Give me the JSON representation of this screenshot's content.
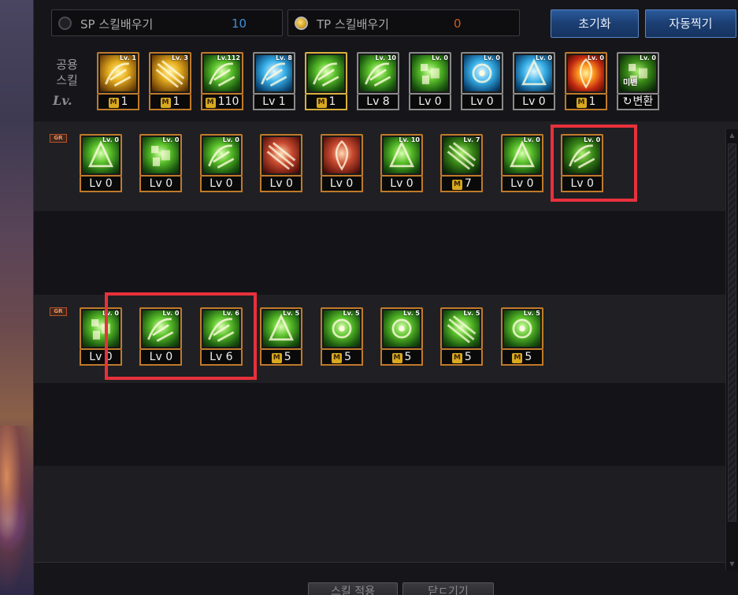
{
  "top_bar": {
    "sp": {
      "label": "SP 스킬배우기",
      "value": "10",
      "selected": false
    },
    "tp": {
      "label": "TP 스킬배우기",
      "value": "0",
      "selected": true
    },
    "reset_label": "초기화",
    "auto_label": "자동찍기"
  },
  "common_skills": {
    "label_line1": "공용",
    "label_line2": "스킬",
    "lv_label": "Lv.",
    "items": [
      {
        "icon": "martial-pose-icon",
        "level": "1",
        "tag": "Lv. 1",
        "mastery": true,
        "art": "gold"
      },
      {
        "icon": "crouch-strike-icon",
        "level": "1",
        "tag": "Lv. 3",
        "mastery": true,
        "art": "gold"
      },
      {
        "icon": "power-stance-icon",
        "level": "110",
        "tag": "Lv.112",
        "mastery": true,
        "art": "green"
      },
      {
        "icon": "wings-icon",
        "level": "Lv 1",
        "tag": "Lv. 8",
        "mastery": false,
        "art": "blue"
      },
      {
        "icon": "book-clock-icon",
        "level": "1",
        "tag": "",
        "mastery": true,
        "art": "green"
      },
      {
        "icon": "target-burst-icon",
        "level": "Lv 8",
        "tag": "Lv. 10",
        "mastery": false,
        "art": "green"
      },
      {
        "icon": "kick-icon",
        "level": "Lv 0",
        "tag": "Lv. 0",
        "mastery": false,
        "art": "green"
      },
      {
        "icon": "eye-aura-icon",
        "level": "Lv 0",
        "tag": "Lv. 0",
        "mastery": false,
        "art": "blue"
      },
      {
        "icon": "figure-aura-icon",
        "level": "Lv 0",
        "tag": "Lv. 0",
        "mastery": false,
        "art": "blue"
      },
      {
        "icon": "explosion-icon",
        "level": "1",
        "tag": "Lv. 0",
        "mastery": true,
        "art": "fire"
      },
      {
        "icon": "transform-scroll-icon",
        "level": "변환",
        "tag": "Lv. 0",
        "mastery": false,
        "art": "dkgreen",
        "overlay": "미변"
      }
    ]
  },
  "section1": {
    "tag": "GR",
    "items": [
      {
        "icon": "wind-slash-icon",
        "level": "Lv 0",
        "tag": "Lv. 0",
        "mastery": false,
        "art": "green"
      },
      {
        "icon": "triple-slash-icon",
        "level": "Lv 0",
        "tag": "Lv. 0",
        "mastery": false,
        "art": "green"
      },
      {
        "icon": "spiral-wind-icon",
        "level": "Lv 0",
        "tag": "Lv. 0",
        "mastery": false,
        "art": "green"
      },
      {
        "icon": "dash-strike-icon",
        "level": "Lv 0",
        "tag": "",
        "mastery": false,
        "art": "red"
      },
      {
        "icon": "grid-burst-icon",
        "level": "Lv 0",
        "tag": "",
        "mastery": false,
        "art": "red"
      },
      {
        "icon": "uppercut-icon",
        "level": "Lv 0",
        "tag": "Lv. 10",
        "mastery": false,
        "art": "green"
      },
      {
        "icon": "crescent-icon",
        "level": "7",
        "tag": "Lv. 7",
        "mastery": true,
        "art": "dkgreen"
      },
      {
        "icon": "pillar-icon",
        "level": "Lv 0",
        "tag": "Lv. 0",
        "mastery": false,
        "art": "green"
      },
      {
        "icon": "vortex-icon",
        "level": "Lv 0",
        "tag": "Lv. 0",
        "mastery": false,
        "art": "dkgreen"
      }
    ]
  },
  "section2": {
    "tag": "GR",
    "items": [
      {
        "icon": "leaf-swirl-icon",
        "level": "Lv 0",
        "tag": "Lv. 0",
        "mastery": false,
        "art": "green"
      },
      {
        "icon": "bars-icon",
        "level": "Lv 0",
        "tag": "Lv. 0",
        "mastery": false,
        "art": "green"
      },
      {
        "icon": "blocks-icon",
        "level": "Lv 6",
        "tag": "Lv. 6",
        "mastery": false,
        "art": "green"
      },
      {
        "icon": "cyclone-kick-icon",
        "level": "5",
        "tag": "Lv. 5",
        "mastery": true,
        "art": "green"
      },
      {
        "icon": "storm-icon",
        "level": "5",
        "tag": "Lv. 5",
        "mastery": true,
        "art": "green"
      },
      {
        "icon": "fighter-icon",
        "level": "5",
        "tag": "Lv. 5",
        "mastery": true,
        "art": "green"
      },
      {
        "icon": "dome-icon",
        "level": "5",
        "tag": "Lv. 5",
        "mastery": true,
        "art": "green"
      },
      {
        "icon": "star-burst-icon",
        "level": "5",
        "tag": "Lv. 5",
        "mastery": true,
        "art": "green"
      }
    ]
  },
  "bottom": {
    "apply_label": "스킬 적용",
    "close_label": "닫ㄷ기기"
  }
}
